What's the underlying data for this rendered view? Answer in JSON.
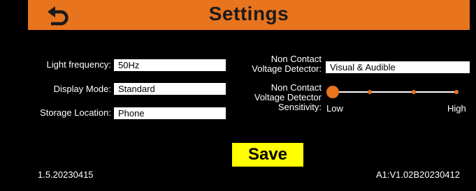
{
  "header": {
    "title": "Settings",
    "back_icon": "back-arrow-icon",
    "color": "#e8741e"
  },
  "settings": {
    "light_frequency": {
      "label": "Light frequency:",
      "value": "50Hz"
    },
    "display_mode": {
      "label": "Display Mode:",
      "value": "Standard"
    },
    "storage_location": {
      "label": "Storage Location:",
      "value": "Phone"
    },
    "ncv_detector": {
      "label_line1": "Non Contact",
      "label_line2": "Voltage Detector:",
      "value": "Visual & Audible"
    },
    "ncv_sensitivity": {
      "label_line1": "Non Contact",
      "label_line2": "Voltage Detector",
      "label_line3": "Sensitivity:",
      "min_label": "Low",
      "max_label": "High",
      "steps": 4,
      "level": 1
    }
  },
  "save_button": {
    "label": "Save",
    "color": "#ffff00"
  },
  "footer": {
    "app_version": "1.5.20230415",
    "firmware_version": "A1:V1.02B20230412"
  }
}
